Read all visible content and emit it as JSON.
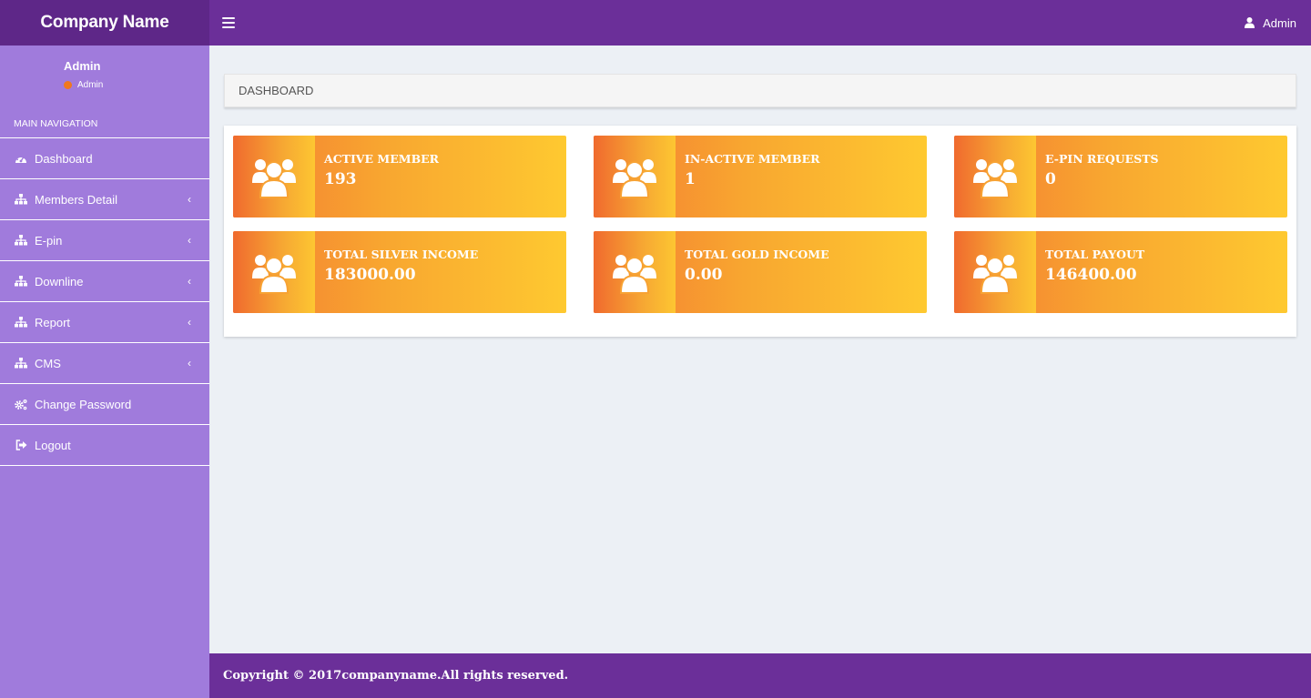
{
  "header": {
    "brand": "Company Name",
    "user_label": "Admin"
  },
  "sidebar": {
    "user_name": "Admin",
    "user_status": "Admin",
    "nav_header": "MAIN NAVIGATION",
    "items": [
      {
        "label": "Dashboard",
        "icon": "dashboard-icon"
      },
      {
        "label": "Members Detail",
        "icon": "sitemap-icon",
        "has_children": true
      },
      {
        "label": "E-pin",
        "icon": "sitemap-icon",
        "has_children": true
      },
      {
        "label": "Downline",
        "icon": "sitemap-icon",
        "has_children": true
      },
      {
        "label": "Report",
        "icon": "sitemap-icon",
        "has_children": true
      },
      {
        "label": "CMS",
        "icon": "sitemap-icon",
        "has_children": true
      },
      {
        "label": "Change Password",
        "icon": "cogs-icon"
      },
      {
        "label": "Logout",
        "icon": "logout-icon"
      }
    ]
  },
  "breadcrumb": {
    "title": "DASHBOARD"
  },
  "stats": [
    {
      "label": "ACTIVE MEMBER",
      "value": "193"
    },
    {
      "label": "IN-ACTIVE MEMBER",
      "value": "1"
    },
    {
      "label": "E-PIN REQUESTS",
      "value": "0"
    },
    {
      "label": "TOTAL SILVER INCOME",
      "value": "183000.00"
    },
    {
      "label": "TOTAL GOLD INCOME",
      "value": "0.00"
    },
    {
      "label": "TOTAL PAYOUT",
      "value": "146400.00"
    }
  ],
  "footer": {
    "text": "Copyright © 2017companyname.All rights reserved."
  },
  "colors": {
    "header": "#6b2f99",
    "sidebar": "#a07bdc",
    "card_start": "#f47a32",
    "card_end": "#fec930",
    "status_dot": "#f0781e"
  }
}
